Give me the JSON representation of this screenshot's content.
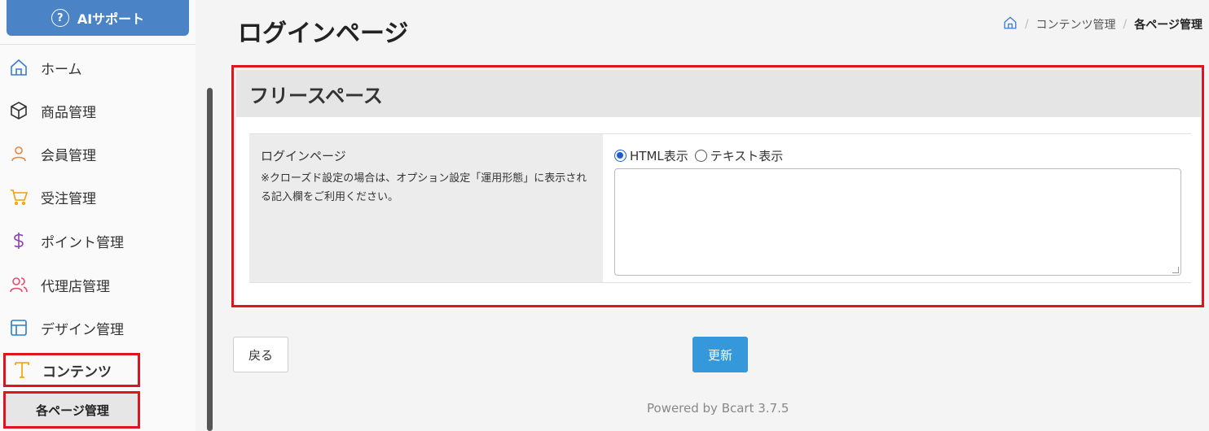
{
  "sidebar": {
    "ai_button": {
      "label": "AIサポート",
      "icon": "question-circle-icon"
    },
    "items": [
      {
        "label": "ホーム",
        "icon": "home-icon",
        "color": "#3a7bd5"
      },
      {
        "label": "商品管理",
        "icon": "box-icon",
        "color": "#333333"
      },
      {
        "label": "会員管理",
        "icon": "user-icon",
        "color": "#e8833a"
      },
      {
        "label": "受注管理",
        "icon": "cart-icon",
        "color": "#f0a000"
      },
      {
        "label": "ポイント管理",
        "icon": "dollar-icon",
        "color": "#8e44ad"
      },
      {
        "label": "代理店管理",
        "icon": "users-icon",
        "color": "#e84a6a"
      },
      {
        "label": "デザイン管理",
        "icon": "layout-icon",
        "color": "#2a7fc9"
      },
      {
        "label": "コンテンツ",
        "icon": "text-icon",
        "color": "#f0a000"
      }
    ],
    "sub_item": {
      "label": "各ページ管理"
    }
  },
  "header": {
    "title": "ログインページ",
    "breadcrumb": [
      "コンテンツ管理",
      "各ページ管理"
    ]
  },
  "panel": {
    "title": "フリースペース",
    "field": {
      "label": "ログインページ",
      "note": "※クローズド設定の場合は、オプション設定「運用形態」に表示される記入欄をご利用ください。",
      "radio_options": [
        "HTML表示",
        "テキスト表示"
      ],
      "selected": "HTML表示",
      "value": ""
    }
  },
  "actions": {
    "back_label": "戻る",
    "update_label": "更新"
  },
  "footer": {
    "text": "Powered by Bcart 3.7.5"
  },
  "colors": {
    "accent": "#3498db",
    "highlight": "#e0141e",
    "ai_button": "#4a83c6"
  }
}
